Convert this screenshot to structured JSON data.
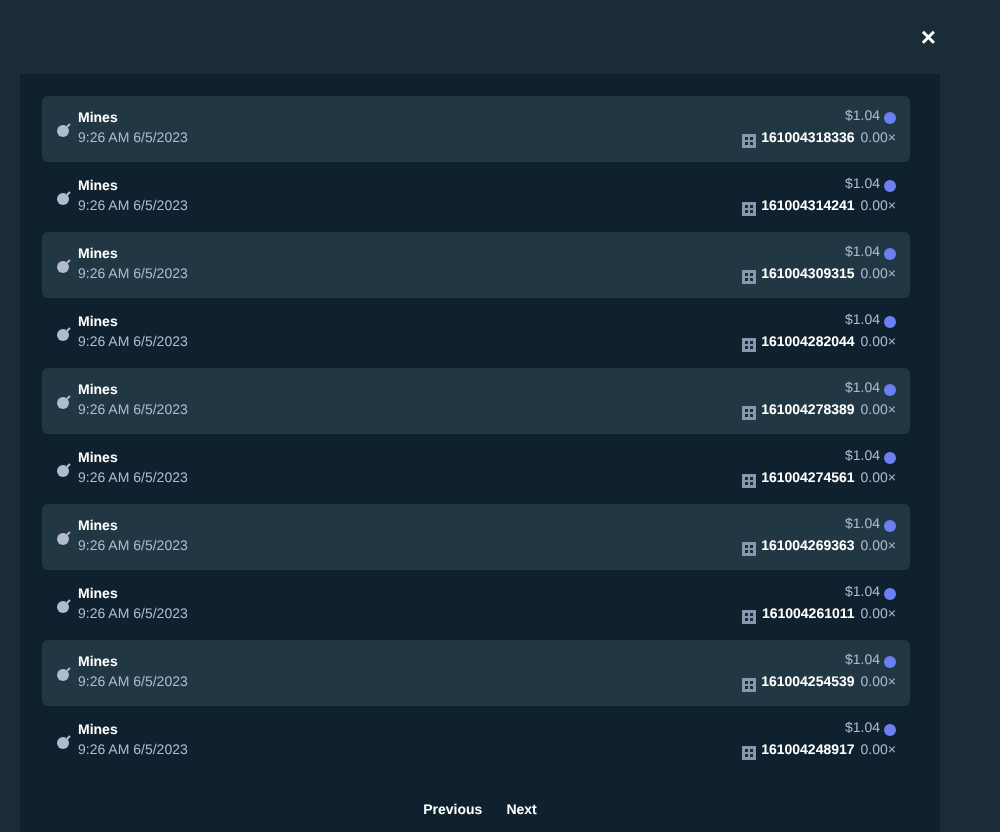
{
  "close": "×",
  "bets": [
    {
      "game": "Mines",
      "time": "9:26 AM 6/5/2023",
      "amount": "$1.04",
      "bet_id": "161004318336",
      "multiplier": "0.00×"
    },
    {
      "game": "Mines",
      "time": "9:26 AM 6/5/2023",
      "amount": "$1.04",
      "bet_id": "161004314241",
      "multiplier": "0.00×"
    },
    {
      "game": "Mines",
      "time": "9:26 AM 6/5/2023",
      "amount": "$1.04",
      "bet_id": "161004309315",
      "multiplier": "0.00×"
    },
    {
      "game": "Mines",
      "time": "9:26 AM 6/5/2023",
      "amount": "$1.04",
      "bet_id": "161004282044",
      "multiplier": "0.00×"
    },
    {
      "game": "Mines",
      "time": "9:26 AM 6/5/2023",
      "amount": "$1.04",
      "bet_id": "161004278389",
      "multiplier": "0.00×"
    },
    {
      "game": "Mines",
      "time": "9:26 AM 6/5/2023",
      "amount": "$1.04",
      "bet_id": "161004274561",
      "multiplier": "0.00×"
    },
    {
      "game": "Mines",
      "time": "9:26 AM 6/5/2023",
      "amount": "$1.04",
      "bet_id": "161004269363",
      "multiplier": "0.00×"
    },
    {
      "game": "Mines",
      "time": "9:26 AM 6/5/2023",
      "amount": "$1.04",
      "bet_id": "161004261011",
      "multiplier": "0.00×"
    },
    {
      "game": "Mines",
      "time": "9:26 AM 6/5/2023",
      "amount": "$1.04",
      "bet_id": "161004254539",
      "multiplier": "0.00×"
    },
    {
      "game": "Mines",
      "time": "9:26 AM 6/5/2023",
      "amount": "$1.04",
      "bet_id": "161004248917",
      "multiplier": "0.00×"
    }
  ],
  "pagination": {
    "previous": "Previous",
    "next": "Next"
  }
}
